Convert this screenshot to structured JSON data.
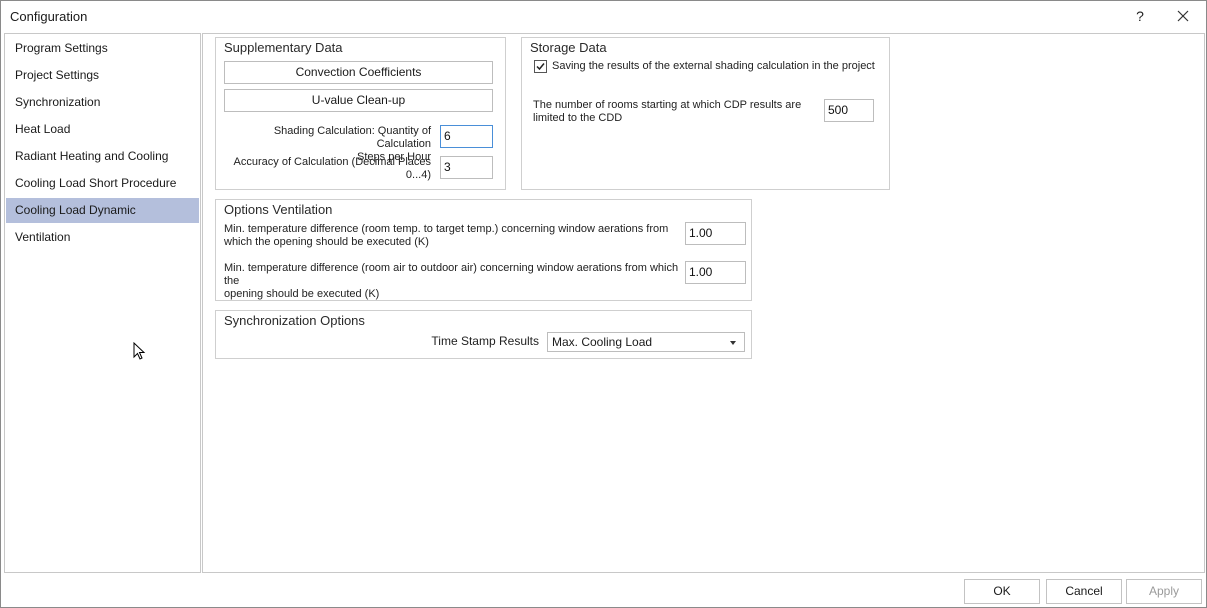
{
  "window": {
    "title": "Configuration",
    "help_label": "?"
  },
  "nav": {
    "items": [
      {
        "label": "Program Settings"
      },
      {
        "label": "Project Settings"
      },
      {
        "label": "Synchronization"
      },
      {
        "label": "Heat Load"
      },
      {
        "label": "Radiant Heating and Cooling"
      },
      {
        "label": "Cooling Load Short Procedure"
      },
      {
        "label": "Cooling Load Dynamic"
      },
      {
        "label": "Ventilation"
      }
    ],
    "selected": "Cooling Load Dynamic"
  },
  "supplementary": {
    "title": "Supplementary Data",
    "convection_button": "Convection Coefficients",
    "uvalue_button": "U-value Clean-up",
    "shading_label_1": "Shading Calculation: Quantity of Calculation",
    "shading_label_2": "Steps per Hour",
    "shading_value": "6",
    "accuracy_label_1": "Accuracy of Calculation (Decimal Places",
    "accuracy_label_2": "0...4)",
    "accuracy_value": "3"
  },
  "storage": {
    "title": "Storage Data",
    "save_shading_label": "Saving the results of the external shading calculation in the project",
    "save_shading_checked": true,
    "rooms_label_1": "The number of rooms starting at which CDP results are",
    "rooms_label_2": "limited to the CDD",
    "rooms_value": "500"
  },
  "ventilation": {
    "title": "Options Ventilation",
    "min_temp_target_label_1": "Min. temperature difference (room temp. to target temp.) concerning window aerations from",
    "min_temp_target_label_2": "which the opening should be executed (K)",
    "min_temp_target_value": "1.00",
    "min_temp_outdoor_label_1": "Min. temperature difference (room air to outdoor air) concerning window aerations from which the",
    "min_temp_outdoor_label_2": "opening should be executed (K)",
    "min_temp_outdoor_value": "1.00"
  },
  "sync_options": {
    "title": "Synchronization Options",
    "timestamp_label": "Time Stamp Results",
    "timestamp_value": "Max. Cooling Load"
  },
  "footer": {
    "ok": "OK",
    "cancel": "Cancel",
    "apply": "Apply"
  },
  "colors": {
    "selected_nav": "#b4bfdc",
    "focus_border": "#4a8fd8",
    "disabled_text": "#9a9a9a"
  }
}
